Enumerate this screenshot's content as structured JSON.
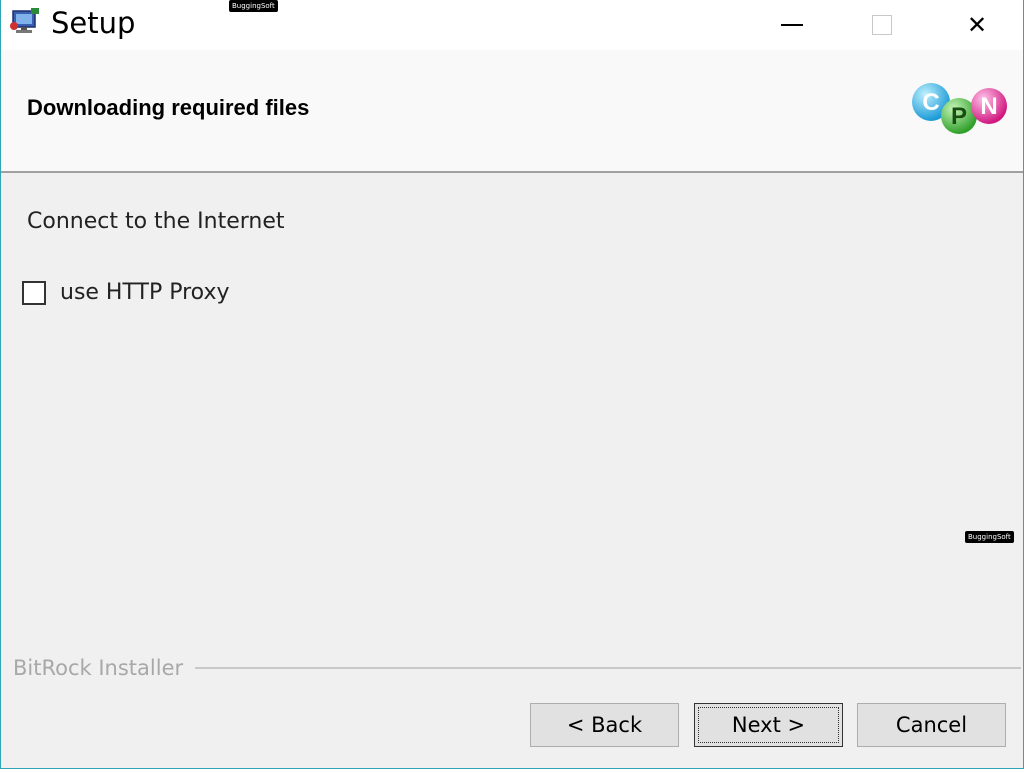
{
  "window": {
    "title": "Setup",
    "controls": {
      "minimize_icon": "minimize-icon",
      "maximize_icon": "maximize-icon",
      "close_icon": "close-icon",
      "close_glyph": "✕"
    }
  },
  "header": {
    "title": "Downloading required files",
    "logo_letters": [
      "C",
      "P",
      "N"
    ]
  },
  "content": {
    "section_label": "Connect to the Internet",
    "proxy_checkbox": {
      "label": "use HTTP Proxy",
      "checked": false
    }
  },
  "watermarks": {
    "text": "BuggingSoft"
  },
  "footer": {
    "brand": "BitRock Installer",
    "buttons": {
      "back": "< Back",
      "next": "Next >",
      "cancel": "Cancel"
    }
  },
  "colors": {
    "window_border": "#2fa6b8",
    "logo_c": "#29a9e0",
    "logo_p": "#49b948",
    "logo_n": "#e0309a"
  }
}
